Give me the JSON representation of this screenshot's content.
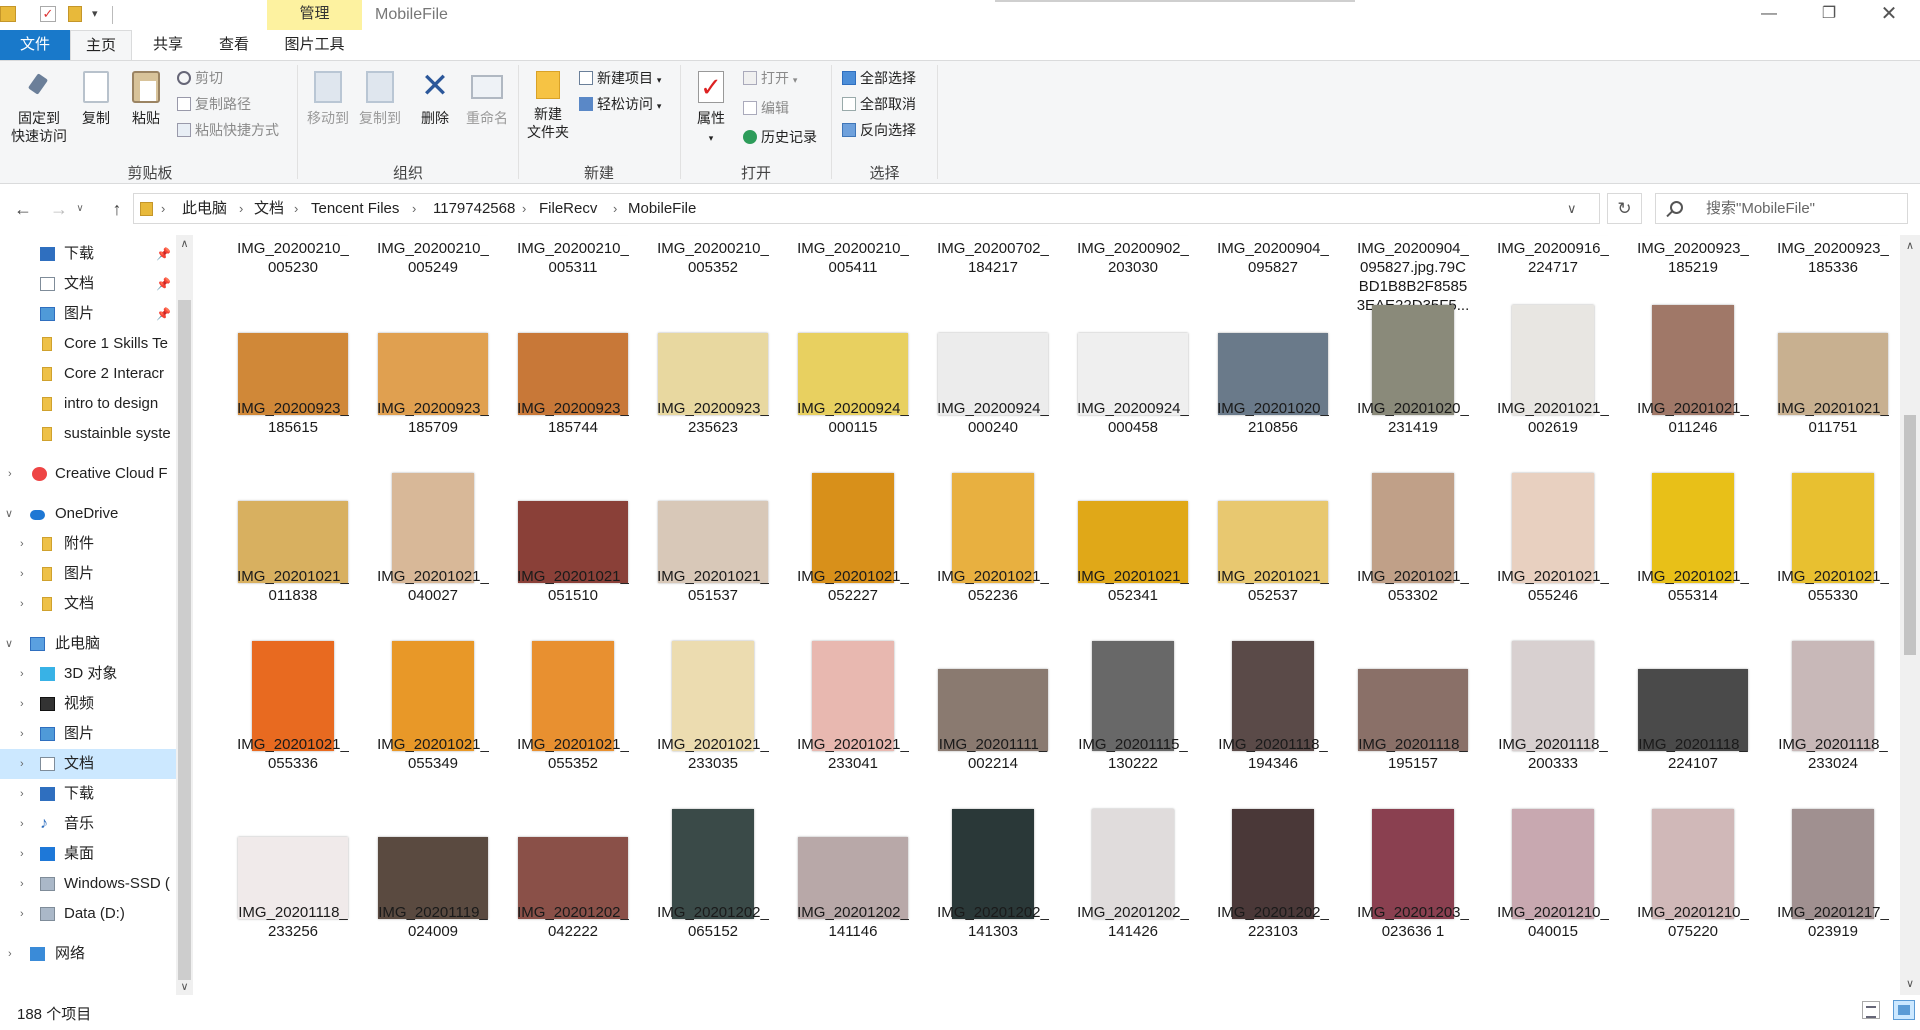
{
  "window": {
    "title": "MobileFile",
    "manage_tab": "管理",
    "controls": {
      "minimize": "—",
      "maximize": "❐",
      "close": "✕"
    }
  },
  "ribbon_tabs": {
    "file": "文件",
    "home": "主页",
    "share": "共享",
    "view": "查看",
    "picture_tools": "图片工具"
  },
  "ribbon": {
    "clipboard": {
      "label": "剪贴板",
      "pin_line1": "固定到",
      "pin_line2": "快速访问",
      "copy": "复制",
      "paste": "粘贴",
      "cut": "剪切",
      "copy_path": "复制路径",
      "paste_shortcut": "粘贴快捷方式"
    },
    "organize": {
      "label": "组织",
      "move_to": "移动到",
      "copy_to": "复制到",
      "delete": "删除",
      "rename": "重命名"
    },
    "new": {
      "label": "新建",
      "new_folder_line1": "新建",
      "new_folder_line2": "文件夹",
      "new_item": "新建项目",
      "easy_access": "轻松访问"
    },
    "open": {
      "label": "打开",
      "properties": "属性",
      "open": "打开",
      "edit": "编辑",
      "history": "历史记录"
    },
    "select": {
      "label": "选择",
      "select_all": "全部选择",
      "select_none": "全部取消",
      "invert": "反向选择"
    }
  },
  "address": {
    "crumbs": [
      "此电脑",
      "文档",
      "Tencent Files",
      "1179742568",
      "FileRecv",
      "MobileFile"
    ],
    "search_placeholder": "搜索\"MobileFile\""
  },
  "nav": [
    {
      "label": "下载",
      "icon": "download-icon",
      "pinned": true
    },
    {
      "label": "文档",
      "icon": "document-icon",
      "pinned": true
    },
    {
      "label": "图片",
      "icon": "pictures-icon",
      "pinned": true
    },
    {
      "label": "Core 1 Skills Te",
      "icon": "folder-icon"
    },
    {
      "label": "Core 2 Interacr",
      "icon": "folder-icon"
    },
    {
      "label": "intro to design",
      "icon": "folder-icon"
    },
    {
      "label": "sustainble syste",
      "icon": "folder-icon"
    },
    {
      "label": "Creative Cloud F",
      "icon": "creative-cloud-icon"
    },
    {
      "label": "OneDrive",
      "icon": "onedrive-icon"
    },
    {
      "label": "附件",
      "icon": "folder-icon"
    },
    {
      "label": "图片",
      "icon": "folder-icon"
    },
    {
      "label": "文档",
      "icon": "folder-icon"
    },
    {
      "label": "此电脑",
      "icon": "this-pc-icon"
    },
    {
      "label": "3D 对象",
      "icon": "3d-objects-icon"
    },
    {
      "label": "视频",
      "icon": "videos-icon"
    },
    {
      "label": "图片",
      "icon": "pictures-icon"
    },
    {
      "label": "文档",
      "icon": "document-icon"
    },
    {
      "label": "下载",
      "icon": "download-icon"
    },
    {
      "label": "音乐",
      "icon": "music-icon"
    },
    {
      "label": "桌面",
      "icon": "desktop-icon"
    },
    {
      "label": "Windows-SSD (",
      "icon": "drive-icon"
    },
    {
      "label": "Data (D:)",
      "icon": "drive-icon"
    },
    {
      "label": "网络",
      "icon": "network-icon"
    }
  ],
  "files": {
    "row0": [
      "IMG_20200210_\n005230",
      "IMG_20200210_\n005249",
      "IMG_20200210_\n005311",
      "IMG_20200210_\n005352",
      "IMG_20200210_\n005411",
      "IMG_20200702_\n184217",
      "IMG_20200902_\n203030",
      "IMG_20200904_\n095827",
      "IMG_20200904_\n095827.jpg.79C\nBD1B8B2F8585\n3EAE22D35F5...",
      "IMG_20200916_\n224717",
      "IMG_20200923_\n185219",
      "IMG_20200923_\n185336"
    ],
    "row1": [
      "IMG_20200923_\n185615",
      "IMG_20200923_\n185709",
      "IMG_20200923_\n185744",
      "IMG_20200923_\n235623",
      "IMG_20200924_\n000115",
      "IMG_20200924_\n000240",
      "IMG_20200924_\n000458",
      "IMG_20201020_\n210856",
      "IMG_20201020_\n231419",
      "IMG_20201021_\n002619",
      "IMG_20201021_\n011246",
      "IMG_20201021_\n011751"
    ],
    "row2": [
      "IMG_20201021_\n011838",
      "IMG_20201021_\n040027",
      "IMG_20201021_\n051510",
      "IMG_20201021_\n051537",
      "IMG_20201021_\n052227",
      "IMG_20201021_\n052236",
      "IMG_20201021_\n052341",
      "IMG_20201021_\n052537",
      "IMG_20201021_\n053302",
      "IMG_20201021_\n055246",
      "IMG_20201021_\n055314",
      "IMG_20201021_\n055330"
    ],
    "row3": [
      "IMG_20201021_\n055336",
      "IMG_20201021_\n055349",
      "IMG_20201021_\n055352",
      "IMG_20201021_\n233035",
      "IMG_20201021_\n233041",
      "IMG_20201111_\n002214",
      "IMG_20201115_\n130222",
      "IMG_20201118_\n194346",
      "IMG_20201118_\n195157",
      "IMG_20201118_\n200333",
      "IMG_20201118_\n224107",
      "IMG_20201118_\n233024"
    ],
    "row4": [
      "IMG_20201118_\n233256",
      "IMG_20201119_\n024009",
      "IMG_20201202_\n042222",
      "IMG_20201202_\n065152",
      "IMG_20201202_\n141146",
      "IMG_20201202_\n141303",
      "IMG_20201202_\n141426",
      "IMG_20201202_\n223103",
      "IMG_20201203_\n023636 1",
      "IMG_20201210_\n040015",
      "IMG_20201210_\n075220",
      "IMG_20201217_\n023919"
    ]
  },
  "thumb_colors": {
    "row0": [
      "#a07a5a",
      "#8a6a50",
      "#6b4a3a",
      "#a08060",
      "#9a7a60",
      "#b07040",
      "#8a5a40",
      "#b0a0a8",
      "#f4f4f4",
      "#c0b8b0",
      "#302020",
      "#a05a30"
    ],
    "row1": [
      "#d08838",
      "#e0a050",
      "#c87838",
      "#e8d8a0",
      "#e8d060",
      "#ececec",
      "#efefef",
      "#6a7a8a",
      "#8a8a7a",
      "#e8e6e2",
      "#a07868",
      "#c8b090"
    ],
    "row2": [
      "#d8b060",
      "#d8b898",
      "#8a4038",
      "#d8c8b8",
      "#d8901a",
      "#e8b040",
      "#e0a818",
      "#e8c870",
      "#c0a088",
      "#e8d0c0",
      "#e8c018",
      "#e8c030"
    ],
    "row3": [
      "#e86a20",
      "#e89828",
      "#e89030",
      "#ecdcb0",
      "#e8b8b0",
      "#8a7a70",
      "#686868",
      "#5a4a48",
      "#8a7068",
      "#d8d0d0",
      "#4a4a4a",
      "#c8b8b8"
    ],
    "row4": [
      "#f0eaea",
      "#5a4a40",
      "#8a5048",
      "#3a4a48",
      "#b8a8a8",
      "#2a3838",
      "#e0dcdc",
      "#4a3838",
      "#8a4050",
      "#c8a8b0",
      "#d0b8b8",
      "#a09090"
    ]
  },
  "status": {
    "item_count": "188 个项目"
  }
}
